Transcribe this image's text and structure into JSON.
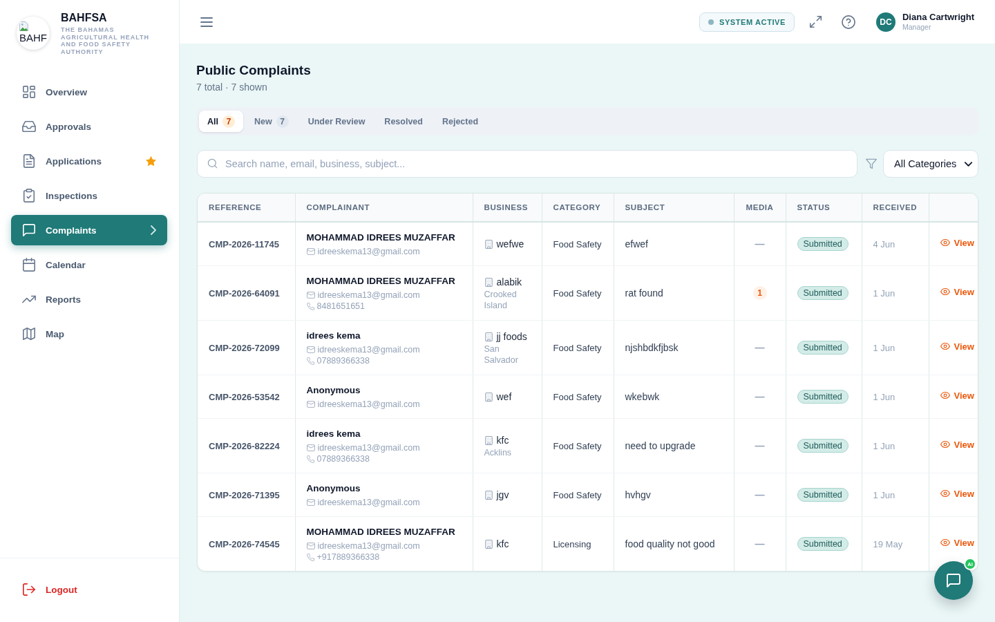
{
  "sidebar": {
    "logo_text": "BAHF",
    "brand": "BAHFSA",
    "tagline": "THE BAHAMAS AGRICULTURAL HEALTH AND FOOD SAFETY AUTHORITY",
    "items": [
      {
        "label": "Overview",
        "selected": false,
        "starred": false
      },
      {
        "label": "Approvals",
        "selected": false,
        "starred": false
      },
      {
        "label": "Applications",
        "selected": false,
        "starred": true
      },
      {
        "label": "Inspections",
        "selected": false,
        "starred": false
      },
      {
        "label": "Complaints",
        "selected": true,
        "starred": false
      },
      {
        "label": "Calendar",
        "selected": false,
        "starred": false
      },
      {
        "label": "Reports",
        "selected": false,
        "starred": false
      },
      {
        "label": "Map",
        "selected": false,
        "starred": false
      }
    ],
    "logout": "Logout"
  },
  "header": {
    "status": "SYSTEM ACTIVE",
    "user": {
      "initials": "DC",
      "name": "Diana Cartwright",
      "role": "Manager"
    }
  },
  "page": {
    "title": "Public Complaints",
    "subtitle": "7 total · 7 shown"
  },
  "tabs": [
    {
      "label": "All",
      "count": "7",
      "selected": true
    },
    {
      "label": "New",
      "count": "7",
      "selected": false
    },
    {
      "label": "Under Review",
      "selected": false
    },
    {
      "label": "Resolved",
      "selected": false
    },
    {
      "label": "Rejected",
      "selected": false
    }
  ],
  "search": {
    "placeholder": "Search name, email, business, subject..."
  },
  "category_filter": {
    "value": "All Categories"
  },
  "table": {
    "columns": [
      "REFERENCE",
      "COMPLAINANT",
      "BUSINESS",
      "CATEGORY",
      "SUBJECT",
      "MEDIA",
      "STATUS",
      "RECEIVED"
    ],
    "rows": [
      {
        "reference": "CMP-2026-11745",
        "complainant": {
          "name": "MOHAMMAD IDREES MUZAFFAR",
          "email": "idreeskema13@gmail.com"
        },
        "business": {
          "name": "wefwe"
        },
        "category": "Food Safety",
        "subject": "efwef",
        "media": {
          "kind": "dash",
          "text": "—"
        },
        "status": "Submitted",
        "received": "4 Jun",
        "action": "View"
      },
      {
        "reference": "CMP-2026-64091",
        "complainant": {
          "name": "MOHAMMAD IDREES MUZAFFAR",
          "email": "idreeskema13@gmail.com",
          "phone": "8481651651"
        },
        "business": {
          "name": "alabik",
          "location": "Crooked Island"
        },
        "category": "Food Safety",
        "subject": "rat found",
        "media": {
          "kind": "count",
          "text": "1"
        },
        "status": "Submitted",
        "received": "1 Jun",
        "action": "View"
      },
      {
        "reference": "CMP-2026-72099",
        "complainant": {
          "name": "idrees kema",
          "email": "idreeskema13@gmail.com",
          "phone": "07889366338"
        },
        "business": {
          "name": "jj foods",
          "location": "San Salvador"
        },
        "category": "Food Safety",
        "subject": "njshbdkfjbsk",
        "media": {
          "kind": "dash",
          "text": "—"
        },
        "status": "Submitted",
        "received": "1 Jun",
        "action": "View"
      },
      {
        "reference": "CMP-2026-53542",
        "complainant": {
          "name": "Anonymous",
          "email": "idreeskema13@gmail.com"
        },
        "business": {
          "name": "wef"
        },
        "category": "Food Safety",
        "subject": "wkebwk",
        "media": {
          "kind": "dash",
          "text": "—"
        },
        "status": "Submitted",
        "received": "1 Jun",
        "action": "View"
      },
      {
        "reference": "CMP-2026-82224",
        "complainant": {
          "name": "idrees kema",
          "email": "idreeskema13@gmail.com",
          "phone": "07889366338"
        },
        "business": {
          "name": "kfc",
          "location": "Acklins"
        },
        "category": "Food Safety",
        "subject": "need to upgrade",
        "media": {
          "kind": "dash",
          "text": "—"
        },
        "status": "Submitted",
        "received": "1 Jun",
        "action": "View"
      },
      {
        "reference": "CMP-2026-71395",
        "complainant": {
          "name": "Anonymous",
          "email": "idreeskema13@gmail.com"
        },
        "business": {
          "name": "jgv"
        },
        "category": "Food Safety",
        "subject": "hvhgv",
        "media": {
          "kind": "dash",
          "text": "—"
        },
        "status": "Submitted",
        "received": "1 Jun",
        "action": "View"
      },
      {
        "reference": "CMP-2026-74545",
        "complainant": {
          "name": "MOHAMMAD IDREES MUZAFFAR",
          "email": "idreeskema13@gmail.com",
          "phone": "+917889366338"
        },
        "business": {
          "name": "kfc"
        },
        "category": "Licensing",
        "subject": "food quality not good",
        "media": {
          "kind": "dash",
          "text": "—"
        },
        "status": "Submitted",
        "received": "19 May",
        "action": "View"
      }
    ]
  },
  "chat": {
    "badge": "AI"
  }
}
